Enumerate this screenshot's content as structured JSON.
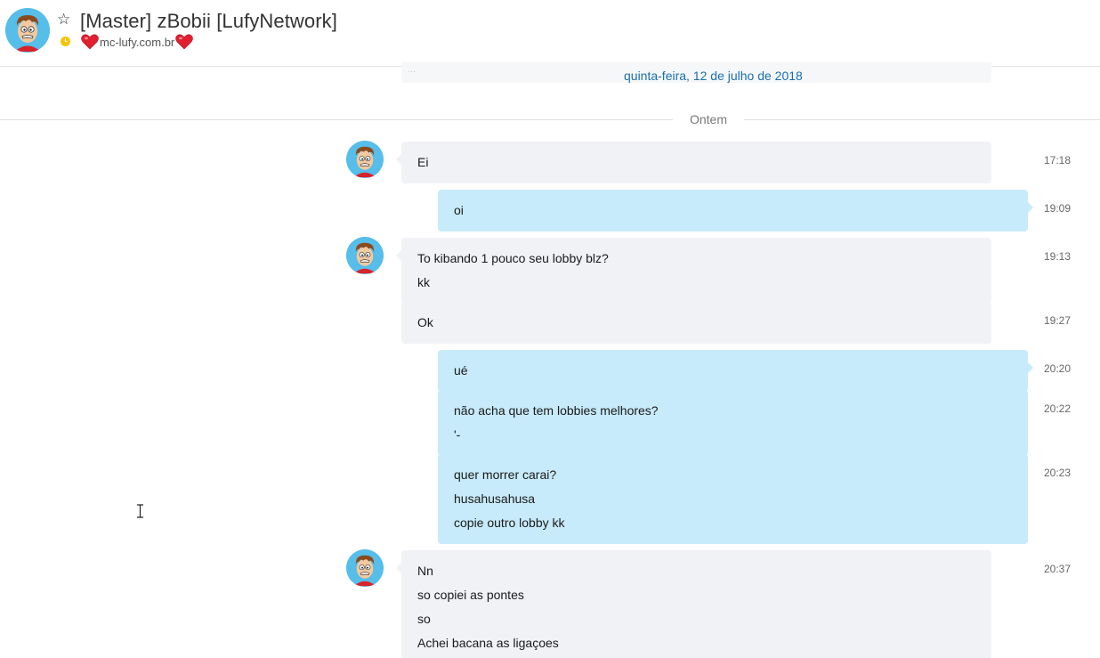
{
  "header": {
    "contact_name": "[Master] zBobii [LufyNetwork]",
    "mood_text": "mc-lufy.com.br",
    "avatar_icon": "cartoon-boy-avatar-icon",
    "favorite_icon": "star-outline-icon",
    "status_icon": "away-clock-icon",
    "status_color": "#f5c400"
  },
  "previous_day": {
    "date_label": "quinta-feira, 12 de julho de 2018",
    "partial_text": "..."
  },
  "divider": {
    "label": "Ontem"
  },
  "colors": {
    "incoming_bubble": "#f0f2f6",
    "outgoing_bubble": "#c7ebfa",
    "link_blue": "#1a6fb0"
  },
  "messages": [
    {
      "sender": "contact",
      "time": "17:18",
      "lines": [
        "Ei"
      ]
    },
    {
      "sender": "me",
      "time": "19:09",
      "lines": [
        "oi"
      ]
    },
    {
      "sender": "contact",
      "time": "19:13",
      "lines": [
        "To kibando 1 pouco seu lobby blz?",
        "kk"
      ]
    },
    {
      "sender": "contact",
      "time": "19:27",
      "lines": [
        "Ok"
      ]
    },
    {
      "sender": "me",
      "time": "20:20",
      "lines": [
        "ué"
      ]
    },
    {
      "sender": "me",
      "time": "20:22",
      "lines": [
        "não acha que tem lobbies melhores?",
        "'-"
      ]
    },
    {
      "sender": "me",
      "time": "20:23",
      "lines": [
        "quer morrer carai?",
        "husahusahusa",
        "copie outro lobby kk"
      ]
    },
    {
      "sender": "contact",
      "time": "20:37",
      "lines": [
        "Nn",
        "so copiei as pontes",
        "so",
        "Achei bacana as ligaçoes"
      ]
    }
  ]
}
